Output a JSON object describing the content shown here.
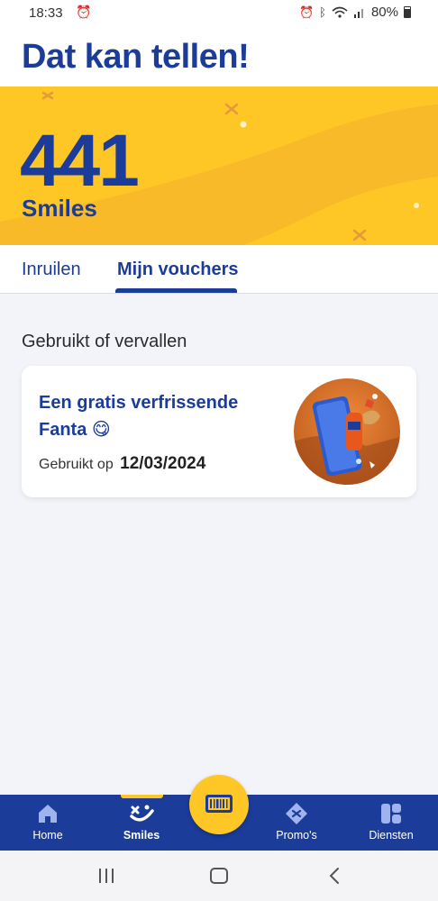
{
  "status_bar": {
    "time": "18:33",
    "battery": "80%",
    "icons": [
      "alarm-icon",
      "bluetooth-icon",
      "wifi-icon",
      "signal-icon",
      "battery-icon"
    ]
  },
  "header": {
    "title": "Dat kan tellen!"
  },
  "smiles": {
    "count": "441",
    "unit": "Smiles",
    "background": "#ffc726"
  },
  "tabs": [
    {
      "label": "Inruilen",
      "active": false
    },
    {
      "label": "Mijn vouchers",
      "active": true
    }
  ],
  "section": {
    "title": "Gebruikt of vervallen"
  },
  "voucher": {
    "title": "Een gratis verfrissende Fanta 😋",
    "date_label": "Gebruikt op",
    "date": "12/03/2024"
  },
  "bottom_nav": {
    "items": [
      {
        "label": "Home",
        "icon": "home-icon"
      },
      {
        "label": "Smiles",
        "icon": "smile-icon",
        "active": true
      },
      {
        "label": "Promo's",
        "icon": "promo-icon"
      },
      {
        "label": "Diensten",
        "icon": "grid-icon"
      }
    ],
    "center_button_icon": "barcode-icon"
  },
  "colors": {
    "brand_blue": "#1c3c9a",
    "brand_yellow": "#ffc726"
  }
}
